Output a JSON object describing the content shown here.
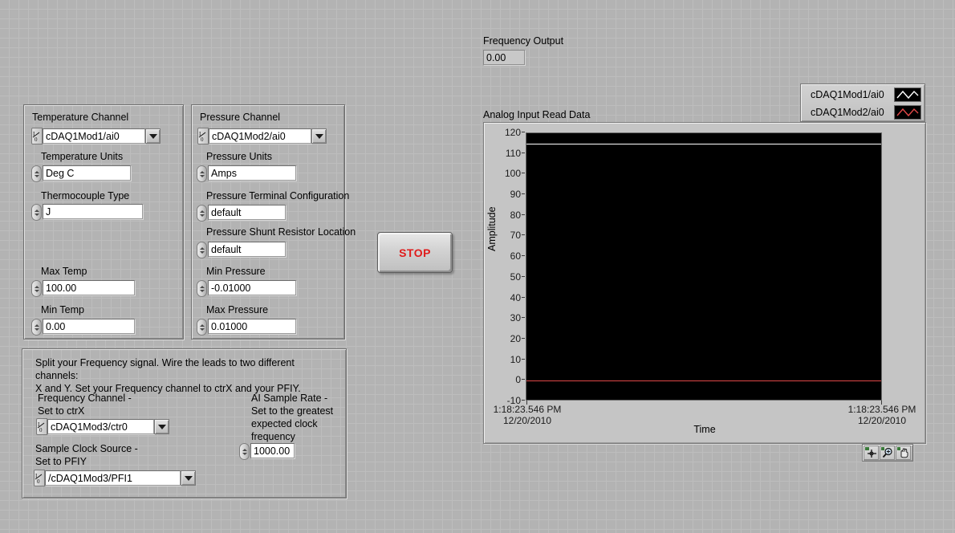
{
  "frequency_output": {
    "label": "Frequency Output",
    "value": "0.00"
  },
  "temperature_panel": {
    "channel_label": "Temperature Channel",
    "channel_value": "cDAQ1Mod1/ai0",
    "units_label": "Temperature Units",
    "units_value": "Deg C",
    "thermocouple_label": "Thermocouple Type",
    "thermocouple_value": "J",
    "max_temp_label": "Max Temp",
    "max_temp_value": "100.00",
    "min_temp_label": "Min Temp",
    "min_temp_value": "0.00"
  },
  "pressure_panel": {
    "channel_label": "Pressure Channel",
    "channel_value": "cDAQ1Mod2/ai0",
    "units_label": "Pressure Units",
    "units_value": "Amps",
    "terminal_label": "Pressure Terminal Configuration",
    "terminal_value": "default",
    "shunt_label": "Pressure Shunt Resistor Location",
    "shunt_value": "default",
    "min_label": "Min Pressure",
    "min_value": "-0.01000",
    "max_label": "Max Pressure",
    "max_value": "0.01000"
  },
  "frequency_panel": {
    "instructions": "Split your Frequency signal.  Wire the leads to two different channels:\nX and Y. Set your Frequency channel to ctrX and your PFIY.",
    "freq_channel_label": "Frequency Channel -\nSet to ctrX",
    "freq_channel_value": "cDAQ1Mod3/ctr0",
    "clock_source_label": "Sample Clock Source -\nSet to PFIY",
    "clock_source_value": "/cDAQ1Mod3/PFI1",
    "sample_rate_label": "AI Sample Rate -\nSet to the greatest\nexpected clock\nfrequency",
    "sample_rate_value": "1000.00"
  },
  "stop_button": {
    "label": "STOP",
    "color": "#e01b1b"
  },
  "graph": {
    "title": "Analog Input Read Data",
    "legend": [
      {
        "label": "cDAQ1Mod1/ai0",
        "color": "#ffffff"
      },
      {
        "label": "cDAQ1Mod2/ai0",
        "color": "#e04848"
      }
    ],
    "palette": {
      "cursor_tool": "crosshair-cursor-icon",
      "zoom_tool": "zoom-magnifier-icon",
      "pan_tool": "pan-hand-icon"
    }
  },
  "chart_data": {
    "type": "line",
    "title": "Analog Input Read Data",
    "xlabel": "Time",
    "ylabel": "Amplitude",
    "ylim": [
      -10,
      120
    ],
    "y_ticks": [
      120,
      110,
      100,
      90,
      80,
      70,
      60,
      50,
      40,
      30,
      20,
      10,
      0,
      -10
    ],
    "x_ticks": [
      "1:18:23.546 PM\n12/20/2010",
      "1:18:23.546 PM\n12/20/2010"
    ],
    "x_tick_times": [
      "1:18:23.546 PM",
      "1:18:23.546 PM"
    ],
    "x_tick_dates": [
      "12/20/2010",
      "12/20/2010"
    ],
    "grid": false,
    "legend_position": "top-right",
    "plot_background": "#000000",
    "series": [
      {
        "name": "cDAQ1Mod1/ai0",
        "color": "#ffffff",
        "constant_value": 115,
        "values": [
          115,
          115
        ]
      },
      {
        "name": "cDAQ1Mod2/ai0",
        "color": "#e04848",
        "constant_value": 0,
        "values": [
          0,
          0
        ]
      }
    ]
  }
}
